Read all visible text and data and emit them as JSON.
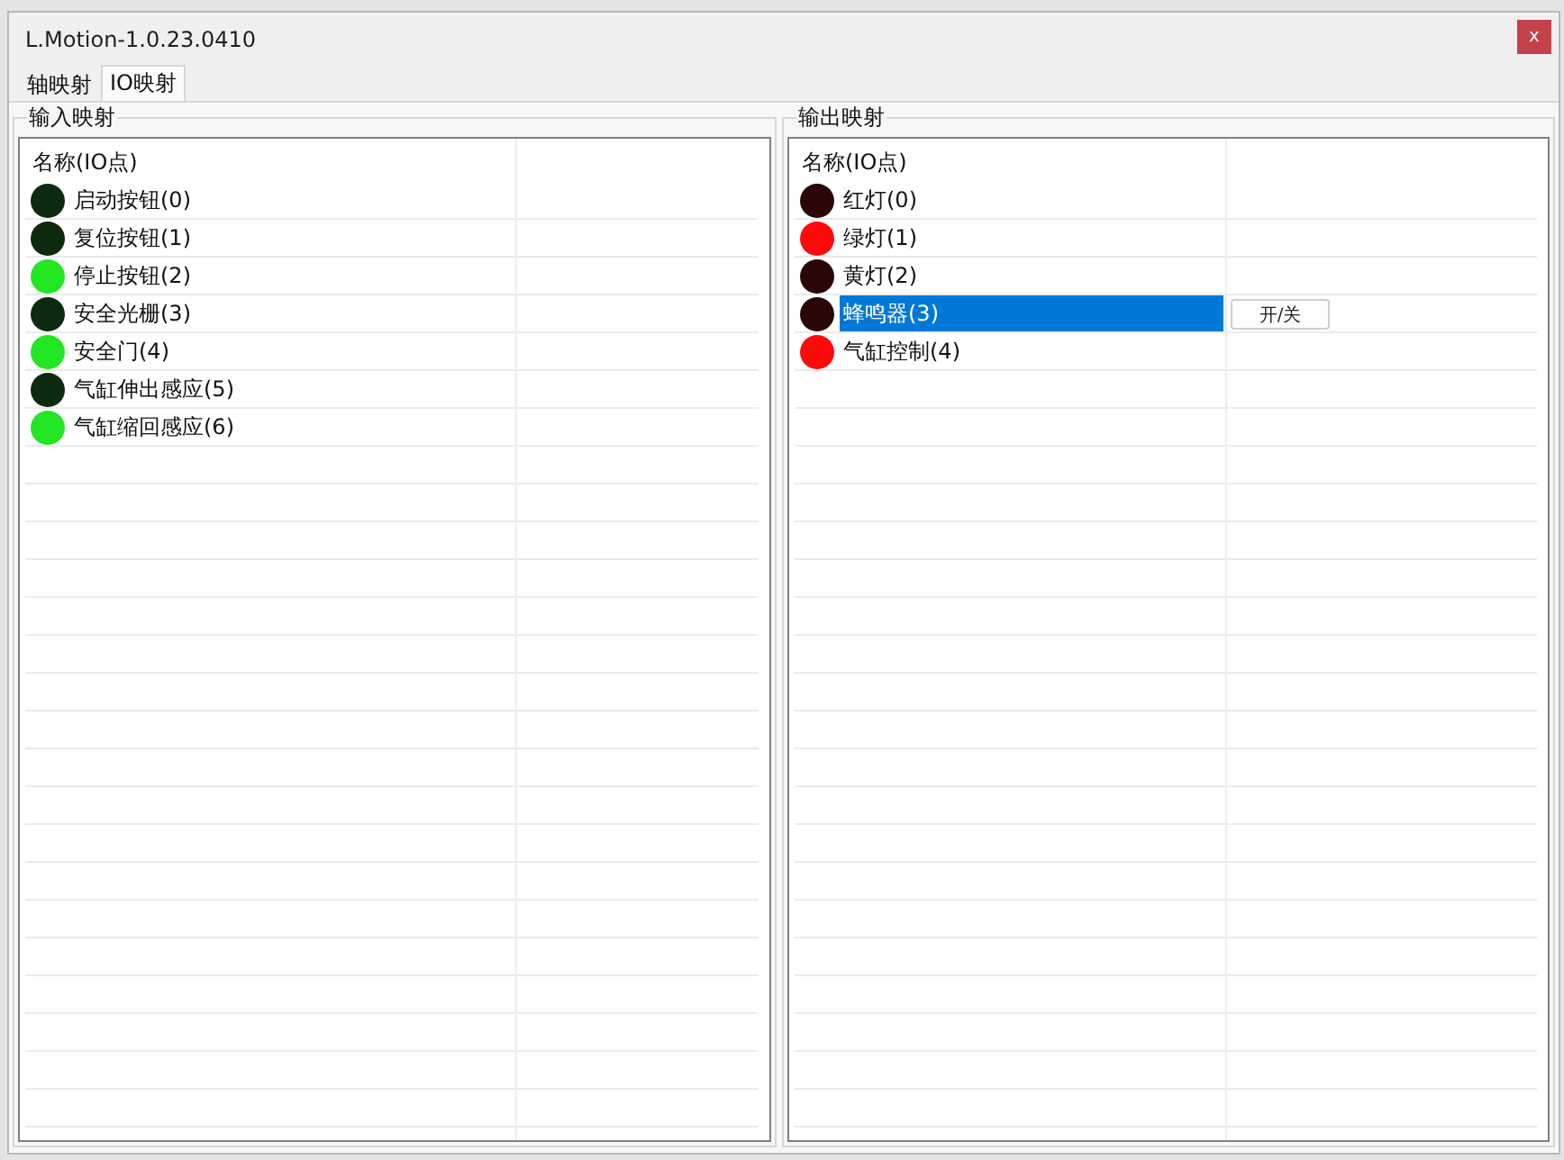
{
  "window": {
    "title": "L.Motion-1.0.23.0410",
    "close_label": "x"
  },
  "tabs": [
    {
      "label": "轴映射",
      "selected": false
    },
    {
      "label": "IO映射",
      "selected": true
    }
  ],
  "groups": [
    {
      "kind": "input",
      "title": "输入映射",
      "column_header": "名称(IO点)",
      "rows": [
        {
          "name": "启动按钮(0)",
          "on": false,
          "selected": false
        },
        {
          "name": "复位按钮(1)",
          "on": false,
          "selected": false
        },
        {
          "name": "停止按钮(2)",
          "on": true,
          "selected": false
        },
        {
          "name": "安全光栅(3)",
          "on": false,
          "selected": false
        },
        {
          "name": "安全门(4)",
          "on": true,
          "selected": false
        },
        {
          "name": "气缸伸出感应(5)",
          "on": false,
          "selected": false
        },
        {
          "name": "气缸缩回感应(6)",
          "on": true,
          "selected": false
        }
      ]
    },
    {
      "kind": "output",
      "title": "输出映射",
      "column_header": "名称(IO点)",
      "rows": [
        {
          "name": "红灯(0)",
          "on": false,
          "selected": false
        },
        {
          "name": "绿灯(1)",
          "on": true,
          "selected": false
        },
        {
          "name": "黄灯(2)",
          "on": false,
          "selected": false
        },
        {
          "name": "蜂鸣器(3)",
          "on": false,
          "selected": true,
          "button": "开/关"
        },
        {
          "name": "气缸控制(4)",
          "on": true,
          "selected": false
        }
      ]
    }
  ]
}
